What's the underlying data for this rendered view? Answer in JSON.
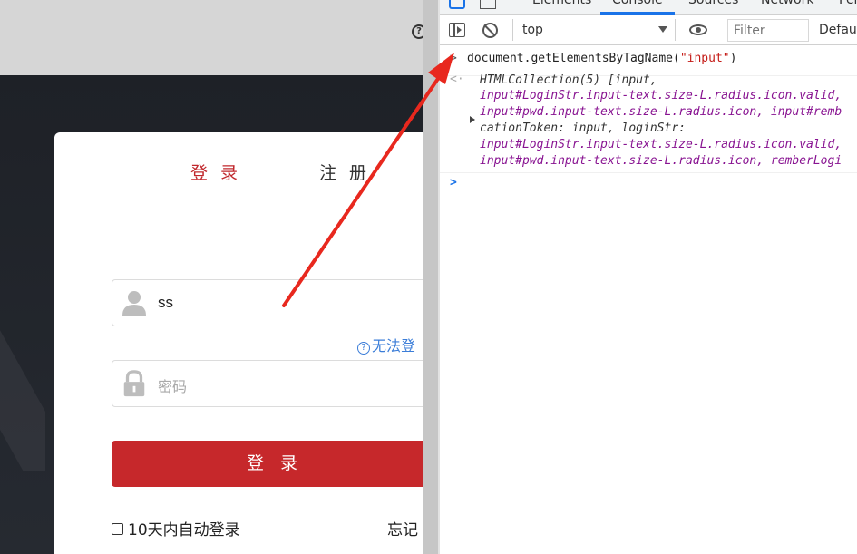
{
  "login_page": {
    "tabs": {
      "login": "登 录",
      "register": "注 册"
    },
    "username": {
      "value": "ss"
    },
    "password": {
      "placeholder": "密码"
    },
    "cannot_login_link": "无法登",
    "login_button": "登 录",
    "auto_login_label": "10天内自动登录",
    "forgot_password_link": "忘记",
    "colors": {
      "accent": "#c6282b",
      "link": "#3b7dd8",
      "dark_background": "#22252b"
    }
  },
  "devtools": {
    "tabs": [
      "Elements",
      "Console",
      "Sources",
      "Network",
      "Per"
    ],
    "active_tab": "Console",
    "toolbar": {
      "context": "top",
      "filter_placeholder": "Filter",
      "levels_label": "Defaul"
    },
    "console": {
      "command": "document.getElementsByTagName(",
      "command_arg": "\"input\"",
      "command_close": ")",
      "result_lines": [
        "HTMLCollection(5) [input, ",
        "input#LoginStr.input-text.size-L.radius.icon.valid,",
        "input#pwd.input-text.size-L.radius.icon, input#remb",
        "cationToken: input, loginStr: ",
        "input#LoginStr.input-text.size-L.radius.icon.valid,",
        "input#pwd.input-text.size-L.radius.icon, remberLogi"
      ]
    },
    "colors": {
      "active_tab": "#1a73e8",
      "string": "#c41a16"
    }
  },
  "annotation": {
    "color": "#e8281e"
  }
}
